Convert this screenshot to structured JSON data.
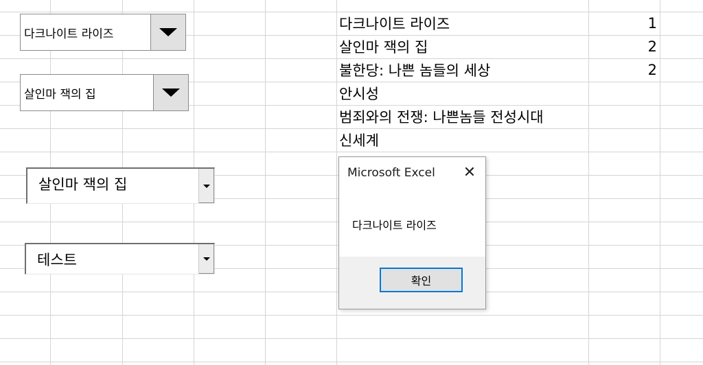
{
  "form_controls": [
    {
      "value": "다크나이트 라이즈"
    },
    {
      "value": "살인마 잭의 집"
    }
  ],
  "activex_controls": [
    {
      "value": "살인마 잭의 집"
    },
    {
      "value": "테스트"
    }
  ],
  "sheet": {
    "rows": [
      {
        "title": "다크나이트 라이즈",
        "count": "1"
      },
      {
        "title": "살인마 잭의 집",
        "count": "2"
      },
      {
        "title": "불한당: 나쁜 놈들의 세상",
        "count": "2"
      },
      {
        "title": "안시성",
        "count": ""
      },
      {
        "title": "범죄와의 전쟁: 나쁜놈들 전성시대",
        "count": ""
      },
      {
        "title": "신세계",
        "count": ""
      }
    ]
  },
  "dialog": {
    "title": "Microsoft Excel",
    "close_glyph": "✕",
    "message": "다크나이트 라이즈",
    "ok_label": "확인"
  },
  "icons": {
    "dropdown": "chevron-down-icon",
    "close": "close-icon"
  },
  "colors": {
    "gridline": "#d4d4d4",
    "button_face": "#e1e1e1",
    "ok_focus_border": "#0078d7",
    "dialog_footer": "#f0f0f0"
  }
}
